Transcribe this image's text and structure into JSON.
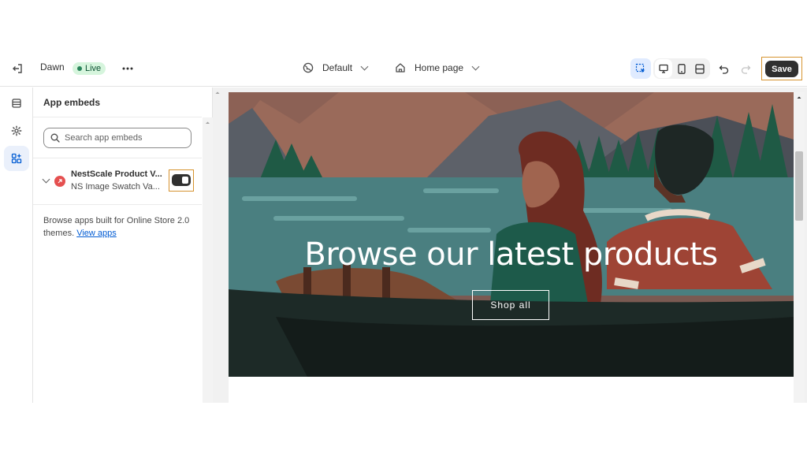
{
  "header": {
    "theme_name": "Dawn",
    "status_badge": "Live",
    "template_select": "Default",
    "page_select": "Home page",
    "save_label": "Save"
  },
  "panel": {
    "title": "App embeds",
    "search_placeholder": "Search app embeds",
    "embed": {
      "name": "NestScale Product V...",
      "subtitle": "NS Image Swatch Va...",
      "enabled": true
    },
    "footer_text": "Browse apps built for Online Store 2.0 themes.",
    "footer_link": "View apps"
  },
  "preview": {
    "hero_heading": "Browse our latest products",
    "hero_button": "Shop all"
  },
  "colors": {
    "accent": "#005bd3",
    "save_bg": "#303030",
    "live_bg": "#d6f5dd",
    "highlight_outline": "#d6932f"
  },
  "icons": [
    "exit-icon",
    "more-horizontal-icon",
    "globe-icon",
    "home-icon",
    "chevron-down-icon",
    "inspect-cursor-icon",
    "desktop-icon",
    "mobile-icon",
    "fullscreen-icon",
    "undo-icon",
    "redo-icon",
    "sections-icon",
    "settings-gear-icon",
    "apps-icon",
    "search-icon",
    "chevron-down-icon"
  ]
}
